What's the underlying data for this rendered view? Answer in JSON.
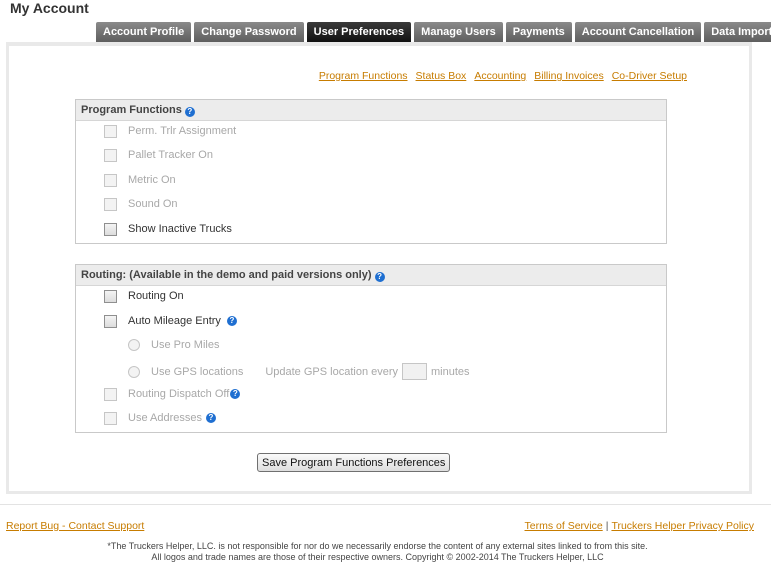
{
  "page": {
    "title": "My Account"
  },
  "tabs": [
    {
      "label": "Account Profile"
    },
    {
      "label": "Change Password"
    },
    {
      "label": "User Preferences"
    },
    {
      "label": "Manage Users"
    },
    {
      "label": "Payments"
    },
    {
      "label": "Account Cancellation"
    },
    {
      "label": "Data Import"
    }
  ],
  "active_tab": "User Preferences",
  "sublinks": [
    {
      "label": "Program Functions"
    },
    {
      "label": "Status Box"
    },
    {
      "label": "Accounting"
    },
    {
      "label": "Billing Invoices"
    },
    {
      "label": "Co-Driver Setup"
    }
  ],
  "program_functions": {
    "title": "Program Functions",
    "items": [
      {
        "label": "Perm. Trlr Assignment",
        "enabled": false,
        "checked": false
      },
      {
        "label": "Pallet Tracker On",
        "enabled": false,
        "checked": false
      },
      {
        "label": "Metric On",
        "enabled": false,
        "checked": false
      },
      {
        "label": "Sound On",
        "enabled": false,
        "checked": false
      },
      {
        "label": "Show Inactive Trucks",
        "enabled": true,
        "checked": false
      }
    ]
  },
  "routing": {
    "title": "Routing: (Available in the demo and paid versions only)",
    "routing_on": "Routing On",
    "auto_mileage": "Auto Mileage Entry",
    "use_pro_miles": "Use Pro Miles",
    "use_gps": "Use GPS locations",
    "update_gps_prefix": "Update GPS location every",
    "update_gps_value": "",
    "update_gps_suffix": "minutes",
    "dispatch_off": "Routing Dispatch Off",
    "use_addresses": "Use Addresses"
  },
  "save_button": "Save Program Functions Preferences",
  "footer": {
    "report_bug": "Report Bug - Contact Support",
    "terms": "Terms of Service",
    "separator": "|",
    "privacy": "Truckers Helper Privacy Policy",
    "disclaimer_line1": "*The Truckers Helper, LLC. is not responsible for nor do we necessarily endorse the content of any external sites linked to from this site.",
    "disclaimer_line2": "All logos and trade names are those of their respective owners. Copyright © 2002-2014 The Truckers Helper, LLC"
  },
  "colors": {
    "link": "#c77c00",
    "help_icon": "#1f6fd1",
    "tab_bg": "#6e6e6e",
    "tab_active_bg": "#1e1e1e"
  }
}
